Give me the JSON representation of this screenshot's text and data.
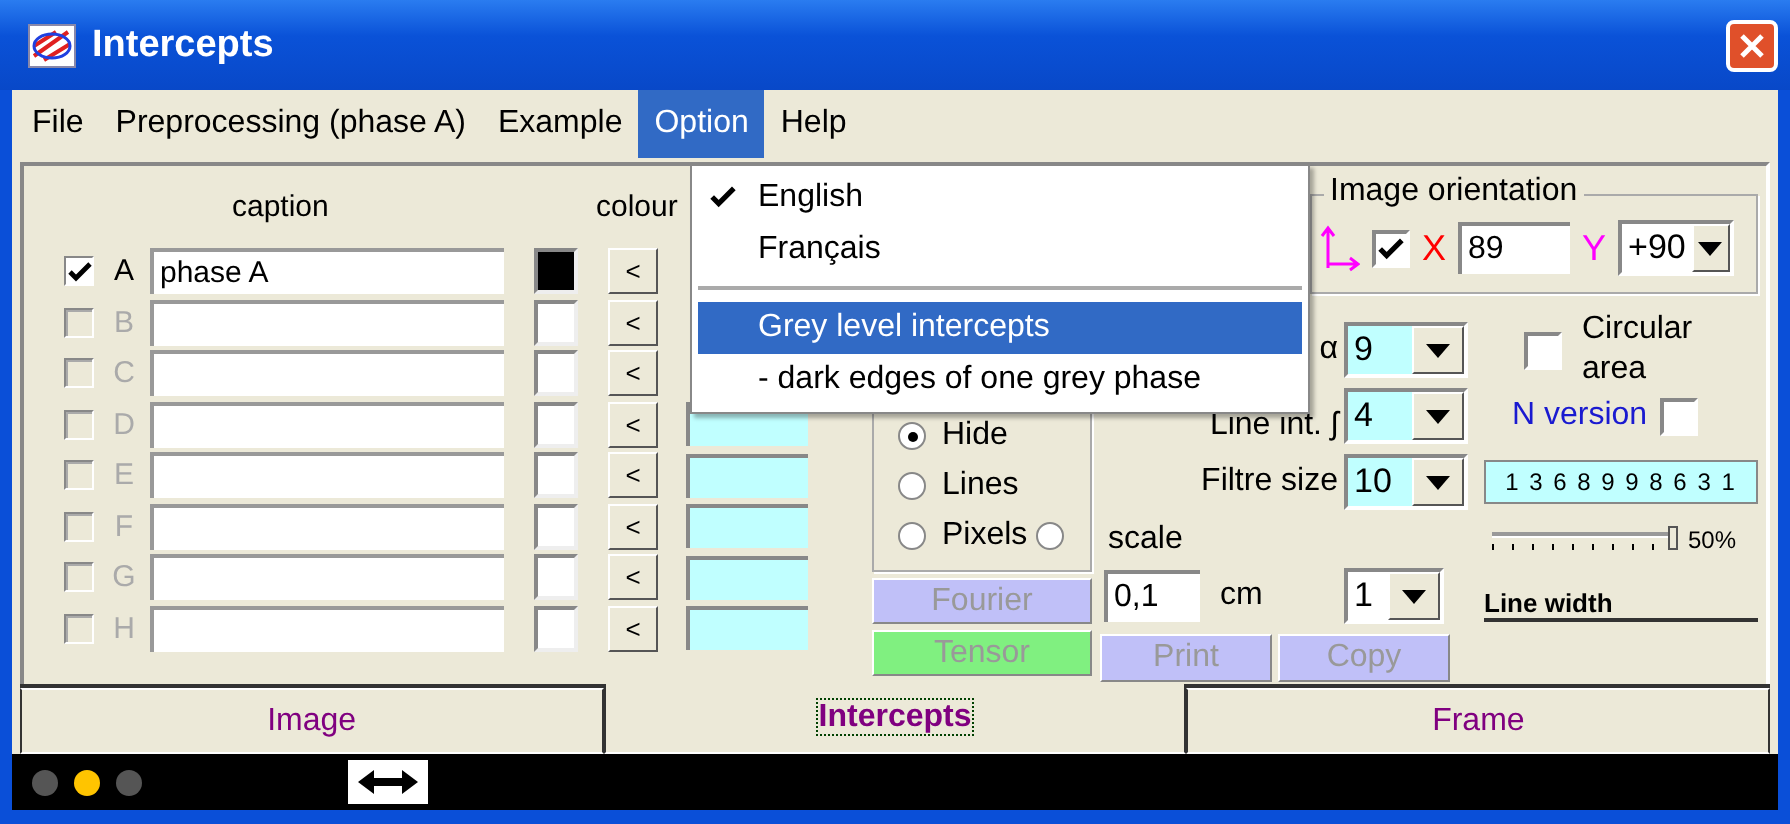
{
  "window": {
    "title": "Intercepts"
  },
  "menu_bar": [
    {
      "label": "File",
      "selected": false
    },
    {
      "label": "Preprocessing (phase A)",
      "selected": false
    },
    {
      "label": "Example",
      "selected": false
    },
    {
      "label": "Option",
      "selected": true
    },
    {
      "label": "Help",
      "selected": false
    }
  ],
  "option_menu": [
    {
      "kind": "item",
      "label": "English",
      "checked": true,
      "highlighted": false
    },
    {
      "kind": "item",
      "label": "Français",
      "checked": false,
      "highlighted": false
    },
    {
      "kind": "separator"
    },
    {
      "kind": "item",
      "label": "Grey level intercepts",
      "checked": false,
      "highlighted": true
    },
    {
      "kind": "item",
      "label": "- dark edges of one grey phase",
      "checked": false,
      "highlighted": false
    }
  ],
  "phases": {
    "caption_header": "caption",
    "colour_header": "colour",
    "rows": [
      {
        "letter": "A",
        "checked": true,
        "disabled": false,
        "caption": "phase A",
        "color": "#000000",
        "button": "<",
        "field_visible": false
      },
      {
        "letter": "B",
        "checked": false,
        "disabled": true,
        "caption": "",
        "color": "#ffffff",
        "button": "<",
        "field_visible": false
      },
      {
        "letter": "C",
        "checked": false,
        "disabled": true,
        "caption": "",
        "color": "#ffffff",
        "button": "<",
        "field_visible": false
      },
      {
        "letter": "D",
        "checked": false,
        "disabled": true,
        "caption": "",
        "color": "#ffffff",
        "button": "<",
        "field_visible": true
      },
      {
        "letter": "E",
        "checked": false,
        "disabled": true,
        "caption": "",
        "color": "#ffffff",
        "button": "<",
        "field_visible": true
      },
      {
        "letter": "F",
        "checked": false,
        "disabled": true,
        "caption": "",
        "color": "#ffffff",
        "button": "<",
        "field_visible": true
      },
      {
        "letter": "G",
        "checked": false,
        "disabled": true,
        "caption": "",
        "color": "#ffffff",
        "button": "<",
        "field_visible": true
      },
      {
        "letter": "H",
        "checked": false,
        "disabled": true,
        "caption": "",
        "color": "#ffffff",
        "button": "<",
        "field_visible": true
      }
    ]
  },
  "display": {
    "radios": [
      {
        "label": "Hide",
        "selected": true
      },
      {
        "label": "Lines",
        "selected": false
      },
      {
        "label": "Pixels",
        "selected": false
      },
      {
        "selected": false
      }
    ],
    "buttons": [
      {
        "label": "Fourier",
        "kind": "lavender",
        "disabled": true
      },
      {
        "label": "Tensor",
        "kind": "green",
        "disabled": true
      }
    ]
  },
  "image_orientation": {
    "title": "Image orientation",
    "checked": true,
    "x_label": "X",
    "x_value": "89",
    "y_label": "Y",
    "y_value": "+90"
  },
  "alpha": {
    "label": "α",
    "value": "9"
  },
  "line_int": {
    "label": "Line int. ʃ",
    "value": "4"
  },
  "filtre_size": {
    "label": "Filtre size",
    "value": "10"
  },
  "circular_area": {
    "label": "Circular area",
    "checked": false
  },
  "n_version": {
    "label": "N version",
    "checked": false
  },
  "sequence": "1 3 6 8 9 9 8 6 3 1",
  "slider": {
    "level": 1,
    "reading": "50%"
  },
  "scale": {
    "label": "scale",
    "value": "0,1",
    "unit": "cm"
  },
  "line_width": {
    "label": "Line width",
    "value": "1"
  },
  "actions": [
    {
      "label": "Print",
      "disabled": true
    },
    {
      "label": "Copy",
      "disabled": true
    }
  ],
  "tabs": [
    {
      "label": "Image",
      "selected": false
    },
    {
      "label": "Intercepts",
      "selected": true
    },
    {
      "label": "Frame",
      "selected": false
    }
  ],
  "status_bar": {
    "dots": [
      {
        "color": "#555555"
      },
      {
        "color": "#ffc400"
      },
      {
        "color": "#555555"
      }
    ]
  }
}
